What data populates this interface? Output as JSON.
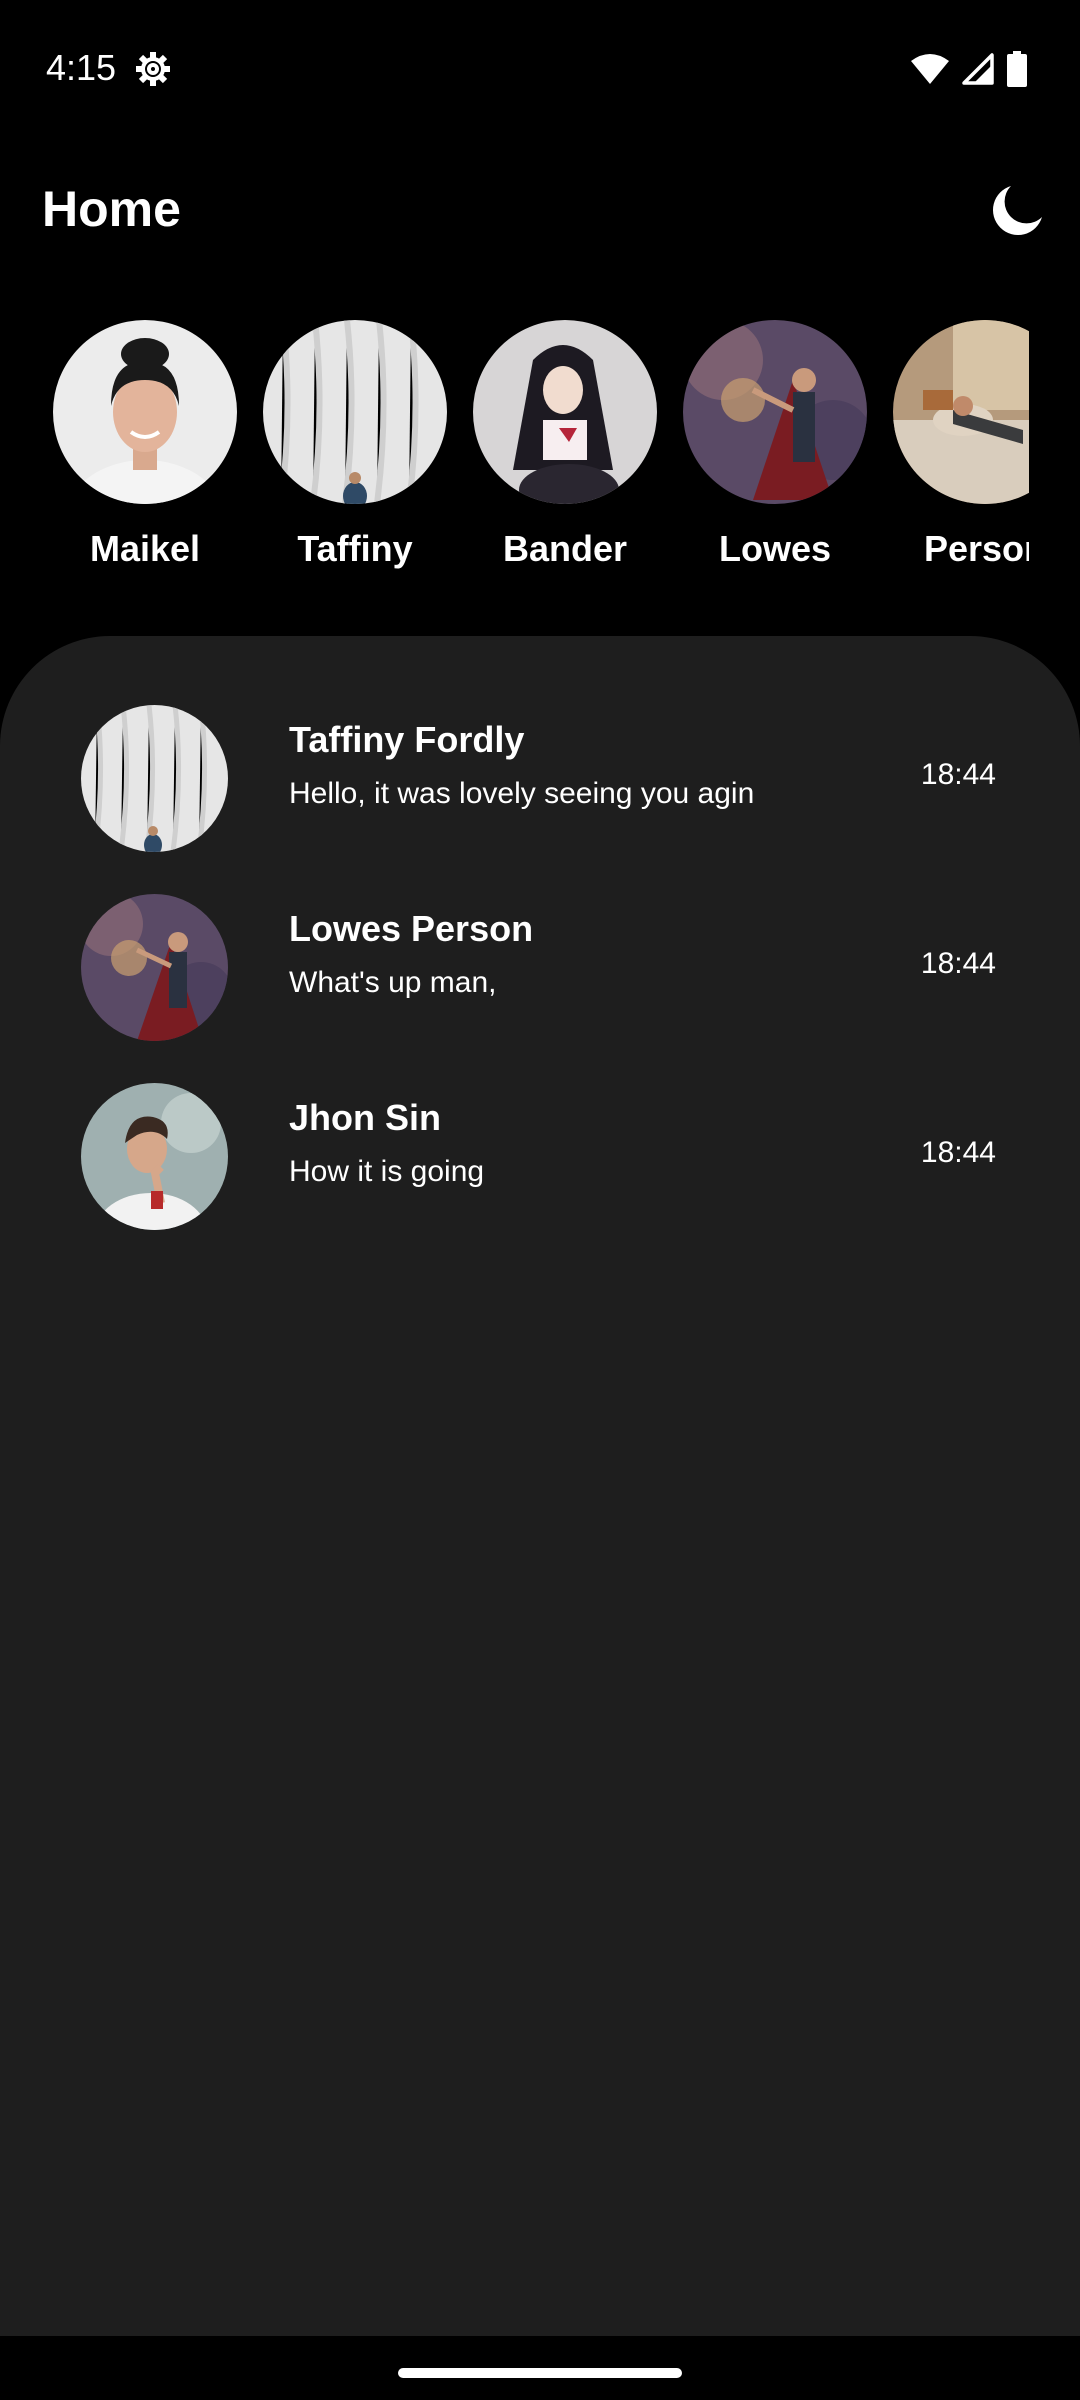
{
  "status_bar": {
    "time": "4:15",
    "icons": [
      "settings-gear-icon",
      "wifi-icon",
      "cellular-signal-icon",
      "battery-icon"
    ]
  },
  "header": {
    "title": "Home",
    "theme_toggle_icon": "moon-icon"
  },
  "stories": [
    {
      "name": "Maikel",
      "avatar": "woman-portrait-photo"
    },
    {
      "name": "Taffiny",
      "avatar": "white-curtain-photo"
    },
    {
      "name": "Bander",
      "avatar": "anime-figure-photo"
    },
    {
      "name": "Lowes",
      "avatar": "caped-hero-figure-photo"
    },
    {
      "name": "Person",
      "avatar": "person-lying-in-bed-photo"
    }
  ],
  "chats": [
    {
      "name": "Taffiny Fordly",
      "message": "Hello, it was lovely seeing you agin",
      "time": "18:44",
      "avatar": "white-curtain-photo"
    },
    {
      "name": "Lowes Person",
      "message": "What's up man,",
      "time": "18:44",
      "avatar": "caped-hero-figure-photo"
    },
    {
      "name": "Jhon Sin",
      "message": "How it is going",
      "time": "18:44",
      "avatar": "woman-pondering-photo"
    }
  ],
  "colors": {
    "background": "#000000",
    "sheet": "#1e1e1e",
    "text": "#ffffff"
  }
}
